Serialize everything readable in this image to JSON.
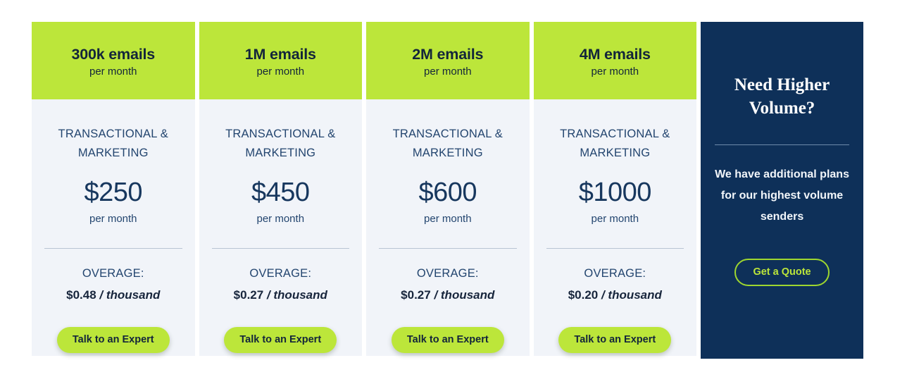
{
  "colors": {
    "accent_green": "#bce63a",
    "navy": "#0e3059",
    "card_body": "#f1f4f9",
    "text_navy": "#17375e",
    "divider": "#b9c4d4"
  },
  "plans": [
    {
      "volume": "300k emails",
      "period_top": "per month",
      "type": "TRANSACTIONAL & MARKETING",
      "price": "$250",
      "price_period": "per month",
      "overage_label": "OVERAGE:",
      "overage_price": "$0.48",
      "overage_unit": "/ thousand",
      "cta_label": "Talk to an Expert"
    },
    {
      "volume": "1M emails",
      "period_top": "per month",
      "type": "TRANSACTIONAL & MARKETING",
      "price": "$450",
      "price_period": "per month",
      "overage_label": "OVERAGE:",
      "overage_price": "$0.27",
      "overage_unit": "/ thousand",
      "cta_label": "Talk to an Expert"
    },
    {
      "volume": "2M emails",
      "period_top": "per month",
      "type": "TRANSACTIONAL & MARKETING",
      "price": "$600",
      "price_period": "per month",
      "overage_label": "OVERAGE:",
      "overage_price": "$0.27",
      "overage_unit": "/ thousand",
      "cta_label": "Talk to an Expert"
    },
    {
      "volume": "4M emails",
      "period_top": "per month",
      "type": "TRANSACTIONAL & MARKETING",
      "price": "$1000",
      "price_period": "per month",
      "overage_label": "OVERAGE:",
      "overage_price": "$0.20",
      "overage_unit": "/ thousand",
      "cta_label": "Talk to an Expert"
    }
  ],
  "upsell": {
    "title": "Need Higher Volume?",
    "body": "We have additional plans for our highest volume senders",
    "cta_label": "Get a Quote"
  }
}
